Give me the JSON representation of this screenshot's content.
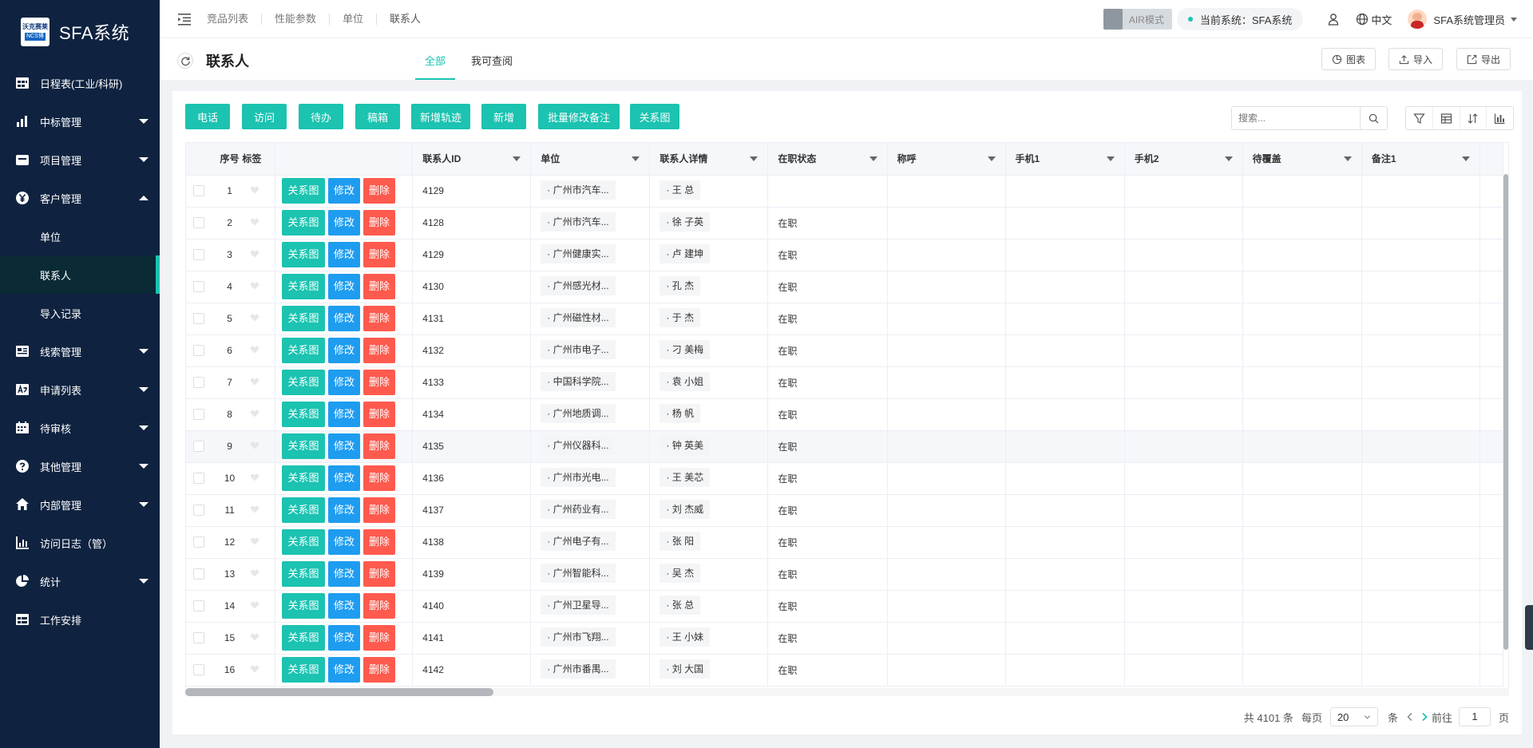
{
  "app": {
    "title": "SFA系统",
    "logo_top": "沃克赛莱",
    "logo_bottom": "NCS博"
  },
  "sidebar": {
    "items": [
      {
        "label": "日程表(工业/科研)",
        "icon": "calendar-icon",
        "has_caret": false
      },
      {
        "label": "中标管理",
        "icon": "bar-chart-icon",
        "has_caret": true
      },
      {
        "label": "项目管理",
        "icon": "folder-icon",
        "has_caret": true
      },
      {
        "label": "客户管理",
        "icon": "yen-icon",
        "has_caret": true,
        "expanded": true
      },
      {
        "label": "线索管理",
        "icon": "list-icon",
        "has_caret": true
      },
      {
        "label": "申请列表",
        "icon": "translate-icon",
        "has_caret": true
      },
      {
        "label": "待审核",
        "icon": "calendar-check-icon",
        "has_caret": true
      },
      {
        "label": "其他管理",
        "icon": "question-icon",
        "has_caret": true
      },
      {
        "label": "内部管理",
        "icon": "home-icon",
        "has_caret": true
      },
      {
        "label": "访问日志（管）",
        "icon": "stats-icon",
        "has_caret": false
      },
      {
        "label": "统计",
        "icon": "pie-icon",
        "has_caret": true
      },
      {
        "label": "工作安排",
        "icon": "table-icon",
        "has_caret": false
      }
    ],
    "sub_items": [
      {
        "label": "单位",
        "active": false
      },
      {
        "label": "联系人",
        "active": true
      },
      {
        "label": "导入记录",
        "active": false
      }
    ]
  },
  "topbar": {
    "breadcrumbs": [
      "竞品列表",
      "性能参数",
      "单位",
      "联系人"
    ],
    "air_mode": "AIR模式",
    "current_system": "当前系统：SFA系统",
    "language": "中文",
    "user": "SFA系统管理员"
  },
  "page": {
    "title": "联系人",
    "tabs": [
      "全部",
      "我可查阅"
    ],
    "active_tab": 0,
    "actions": [
      "图表",
      "导入",
      "导出"
    ]
  },
  "toolbar": {
    "buttons": [
      "电话",
      "访问",
      "待办",
      "稿箱",
      "新增轨迹",
      "新增",
      "批量修改备注",
      "关系图"
    ],
    "search_placeholder": "搜索..."
  },
  "table": {
    "columns": [
      "序号",
      "标签",
      "",
      "联系人ID",
      "单位",
      "联系人详情",
      "在职状态",
      "称呼",
      "手机1",
      "手机2",
      "待覆盖",
      "备注1"
    ],
    "ops": {
      "relation": "关系图",
      "edit": "修改",
      "delete": "删除"
    },
    "rows": [
      {
        "no": "1",
        "id": "4129",
        "unit": "· 广州市汽车...",
        "contact": "· 王 总",
        "status": ""
      },
      {
        "no": "2",
        "id": "4128",
        "unit": "· 广州市汽车...",
        "contact": "· 徐 子英",
        "status": "在职"
      },
      {
        "no": "3",
        "id": "4129",
        "unit": "· 广州健康实...",
        "contact": "· 卢 建坤",
        "status": "在职"
      },
      {
        "no": "4",
        "id": "4130",
        "unit": "· 广州感光材...",
        "contact": "· 孔 杰",
        "status": "在职"
      },
      {
        "no": "5",
        "id": "4131",
        "unit": "· 广州磁性材...",
        "contact": "· 于 杰",
        "status": "在职"
      },
      {
        "no": "6",
        "id": "4132",
        "unit": "· 广州市电子...",
        "contact": "· 刁 美梅",
        "status": "在职"
      },
      {
        "no": "7",
        "id": "4133",
        "unit": "· 中国科学院...",
        "contact": "· 袁 小姐",
        "status": "在职"
      },
      {
        "no": "8",
        "id": "4134",
        "unit": "· 广州地质调...",
        "contact": "· 杨 帆",
        "status": "在职"
      },
      {
        "no": "9",
        "id": "4135",
        "unit": "· 广州仪器科...",
        "contact": "· 钟 英美",
        "status": "在职",
        "highlight": true
      },
      {
        "no": "10",
        "id": "4136",
        "unit": "· 广州市光电...",
        "contact": "· 王 美芯",
        "status": "在职"
      },
      {
        "no": "11",
        "id": "4137",
        "unit": "· 广州药业有...",
        "contact": "· 刘 杰威",
        "status": "在职"
      },
      {
        "no": "12",
        "id": "4138",
        "unit": "· 广州电子有...",
        "contact": "· 张 阳",
        "status": "在职"
      },
      {
        "no": "13",
        "id": "4139",
        "unit": "· 广州智能科...",
        "contact": "· 吴 杰",
        "status": "在职"
      },
      {
        "no": "14",
        "id": "4140",
        "unit": "· 广州卫星导...",
        "contact": "· 张 总",
        "status": "在职"
      },
      {
        "no": "15",
        "id": "4141",
        "unit": "· 广州市飞翔...",
        "contact": "· 王 小妹",
        "status": "在职"
      },
      {
        "no": "16",
        "id": "4142",
        "unit": "· 广州市番禺...",
        "contact": "· 刘 大国",
        "status": "在职"
      }
    ]
  },
  "pagination": {
    "total": "共 4101 条",
    "per_page_label": "每页",
    "per_page": "20",
    "unit": "条",
    "goto": "前往",
    "page": "1",
    "page_suffix": "页"
  },
  "colors": {
    "accent": "#1bc3b0",
    "sidebar_bg": "#0f2340",
    "edit_blue": "#1e9cf0",
    "delete_red": "#ff5a4e"
  }
}
